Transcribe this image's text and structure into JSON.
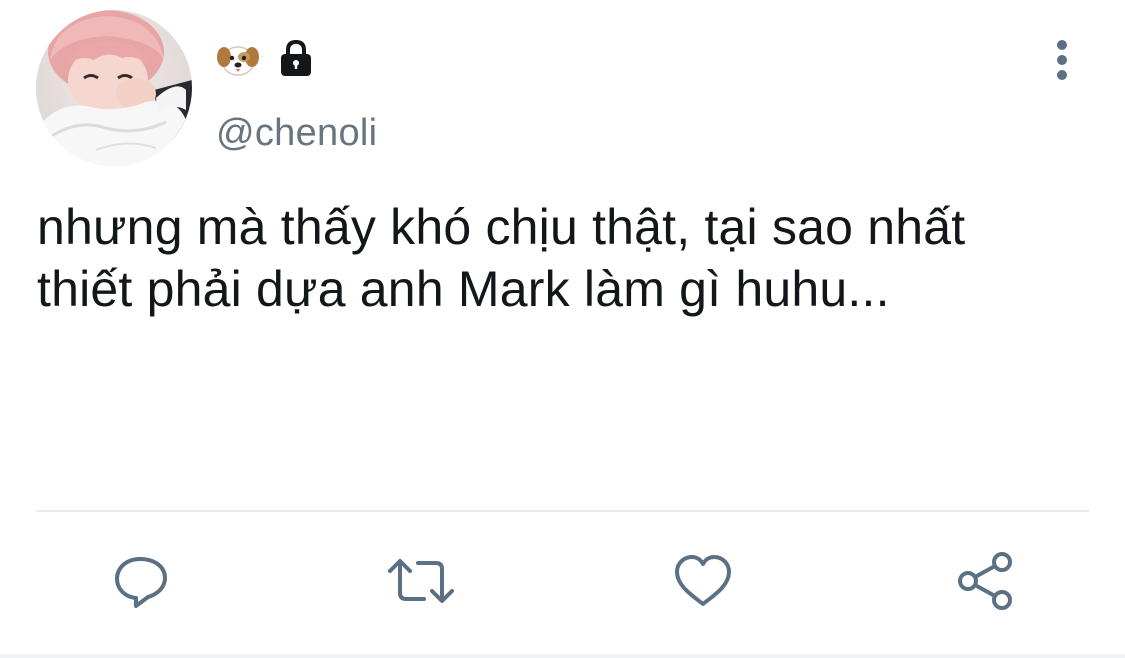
{
  "tweet": {
    "handle": "@chenoli",
    "name_icons": [
      "dog-face-icon",
      "lock-icon"
    ],
    "text": "nhưng mà thấy khó chịu thật, tại sao nhất thiết phải dựa anh Mark làm gì huhu...",
    "more_icon": "vertical-ellipsis-icon"
  },
  "actions": [
    {
      "icon": "reply-icon"
    },
    {
      "icon": "retweet-icon"
    },
    {
      "icon": "like-icon"
    },
    {
      "icon": "share-icon"
    }
  ],
  "colors": {
    "text": "#14171a",
    "secondary": "#66757f",
    "icon": "#5b7083",
    "divider": "#e6ecf0"
  }
}
